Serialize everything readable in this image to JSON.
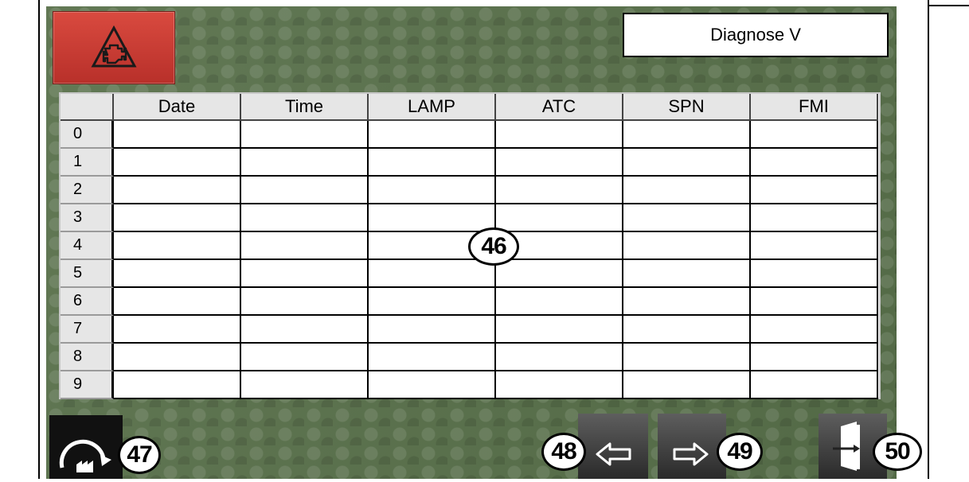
{
  "title": "Diagnose V",
  "table": {
    "columns": [
      "Date",
      "Time",
      "LAMP",
      "ATC",
      "SPN",
      "FMI"
    ],
    "rows": [
      "0",
      "1",
      "2",
      "3",
      "4",
      "5",
      "6",
      "7",
      "8",
      "9"
    ]
  },
  "callouts": {
    "table": "46",
    "reset": "47",
    "prev": "48",
    "next": "49",
    "exit": "50"
  },
  "icons": {
    "alarm": "engine-warning-icon",
    "reset": "factory-reset-icon",
    "prev": "arrow-left-icon",
    "next": "arrow-right-icon",
    "exit": "exit-door-icon"
  },
  "colors": {
    "alarm_red": "#c83a32",
    "background_green": "#58704a"
  }
}
